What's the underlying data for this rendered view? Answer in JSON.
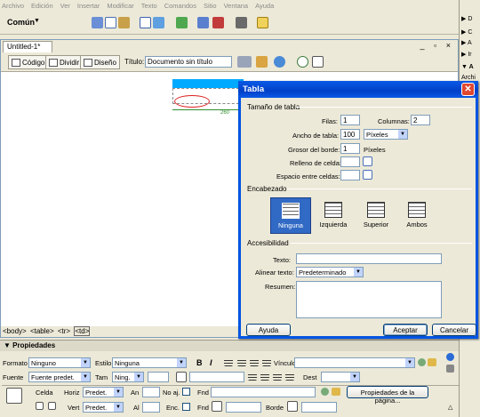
{
  "menubar": [
    "Archivo",
    "Edición",
    "Ver",
    "Insertar",
    "Modificar",
    "Texto",
    "Comandos",
    "Sitio",
    "Ventana",
    "Ayuda"
  ],
  "insertbar": {
    "category": "Común"
  },
  "right_panel": {
    "items": [
      "D",
      "C",
      "A",
      "Ir",
      "A",
      "Archi"
    ]
  },
  "document": {
    "tab": "Untitled-1*",
    "views": {
      "code": "Código",
      "split": "Dividir",
      "design": "Diseño"
    },
    "title_label": "Título:",
    "title_value": "Documento sin título",
    "ruler_value": "260",
    "status_tags": [
      "<body>",
      "<table>",
      "<tr>",
      "<td>"
    ]
  },
  "properties": {
    "header": "Propiedades",
    "formato_label": "Formato",
    "formato_value": "Ninguno",
    "estilo_label": "Estilo",
    "estilo_value": "Ninguna",
    "vinculo_label": "Vínculo",
    "fuente_label": "Fuente",
    "fuente_value": "Fuente predet.",
    "tam_label": "Tam",
    "tam_value": "Ning.",
    "dest_label": "Dest",
    "celda_label": "Celda",
    "horiz_label": "Horiz",
    "horiz_value": "Predet.",
    "an_label": "An",
    "noaj_label": "No aj.",
    "fnd_label": "Fnd",
    "page_props_button": "Propiedades de la página...",
    "vert_label": "Vert",
    "vert_value": "Predet.",
    "al_label": "Al",
    "enc_label": "Enc.",
    "fnd2_label": "Fnd",
    "borde_label": "Borde"
  },
  "dialog": {
    "title": "Tabla",
    "size_section": "Tamaño de tabla",
    "filas_label": "Filas:",
    "filas_value": "1",
    "columnas_label": "Columnas:",
    "columnas_value": "2",
    "ancho_label": "Ancho de tabla:",
    "ancho_value": "100",
    "ancho_unit": "Píxeles",
    "grosor_label": "Grosor del borde:",
    "grosor_value": "1",
    "grosor_unit": "Píxeles",
    "relleno_label": "Relleno de celda:",
    "espacio_label": "Espacio entre celdas:",
    "header_section": "Encabezado",
    "header_options": [
      "Ninguna",
      "Izquierda",
      "Superior",
      "Ambos"
    ],
    "access_section": "Accesibilidad",
    "texto_label": "Texto:",
    "alinear_label": "Alinear texto:",
    "alinear_value": "Predeterminado",
    "resumen_label": "Resumen:",
    "help_button": "Ayuda",
    "ok_button": "Aceptar",
    "cancel_button": "Cancelar"
  },
  "colors": {
    "title_bar": "#0054e3",
    "selected_header": "#316ac5",
    "canvas_table": "#00aaff",
    "ruler_green": "#2f8f2f"
  }
}
